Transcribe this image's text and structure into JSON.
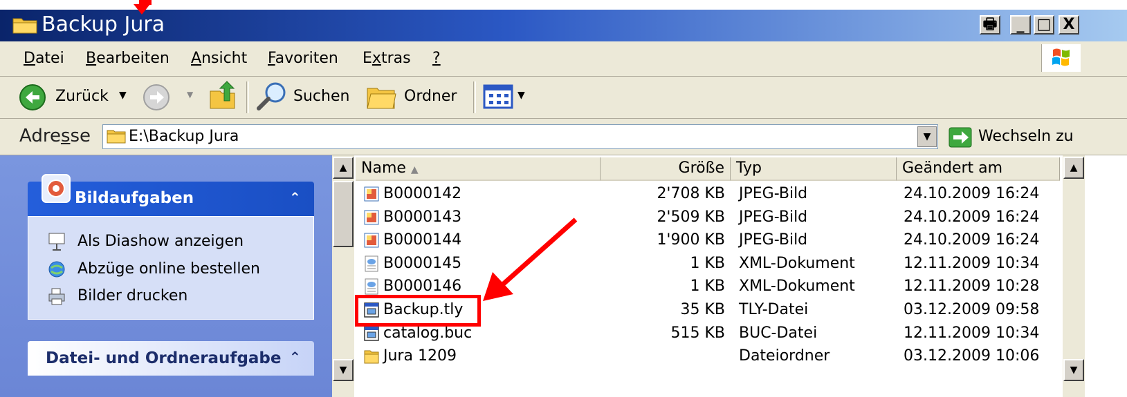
{
  "window": {
    "title": "Backup Jura",
    "buttons": {
      "print": "🖶",
      "minimize": "_",
      "maximize": "□",
      "close": "X"
    }
  },
  "menu": [
    {
      "label": "Datei",
      "u": "D",
      "rest": "atei"
    },
    {
      "label": "Bearbeiten",
      "u": "B",
      "rest": "earbeiten"
    },
    {
      "label": "Ansicht",
      "u": "A",
      "rest": "nsicht"
    },
    {
      "label": "Favoriten",
      "u": "F",
      "rest": "avoriten"
    },
    {
      "label": "Extras",
      "pre": "E",
      "u": "x",
      "rest": "tras"
    },
    {
      "label": "?",
      "u": "?",
      "rest": ""
    }
  ],
  "toolbar": {
    "back_label": "Zurück",
    "search_label": "Suchen",
    "folder_label": "Ordner"
  },
  "address": {
    "label_pre": "Adre",
    "label_u": "s",
    "label_post": "se",
    "value": "E:\\Backup Jura",
    "go_label": "Wechseln zu"
  },
  "left_pane": {
    "panel1_title": "Bildaufgaben",
    "tasks": [
      {
        "label": "Als Diashow anzeigen",
        "icon": "slideshow-icon"
      },
      {
        "label": "Abzüge online bestellen",
        "icon": "order-prints-icon"
      },
      {
        "label": "Bilder drucken",
        "icon": "printer-icon"
      }
    ],
    "panel2_title": "Datei- und Ordneraufgabe",
    "chevron": "⌃"
  },
  "file_list": {
    "columns": [
      "Name",
      "Größe",
      "Typ",
      "Geändert am"
    ],
    "sort_indicator": "▲",
    "rows": [
      {
        "name": "B0000142",
        "size": "2'708 KB",
        "type": "JPEG-Bild",
        "modified": "24.10.2009 16:24",
        "icon": "jpeg-file-icon"
      },
      {
        "name": "B0000143",
        "size": "2'509 KB",
        "type": "JPEG-Bild",
        "modified": "24.10.2009 16:24",
        "icon": "jpeg-file-icon"
      },
      {
        "name": "B0000144",
        "size": "1'900 KB",
        "type": "JPEG-Bild",
        "modified": "24.10.2009 16:24",
        "icon": "jpeg-file-icon"
      },
      {
        "name": "B0000145",
        "size": "1 KB",
        "type": "XML-Dokument",
        "modified": "12.11.2009 10:34",
        "icon": "xml-file-icon"
      },
      {
        "name": "B0000146",
        "size": "1 KB",
        "type": "XML-Dokument",
        "modified": "12.11.2009 10:28",
        "icon": "xml-file-icon"
      },
      {
        "name": "Backup.tly",
        "size": "35 KB",
        "type": "TLY-Datei",
        "modified": "03.12.2009 09:58",
        "icon": "tly-file-icon"
      },
      {
        "name": "catalog.buc",
        "size": "515 KB",
        "type": "BUC-Datei",
        "modified": "12.11.2009 10:34",
        "icon": "buc-file-icon"
      },
      {
        "name": "Jura 1209",
        "size": "",
        "type": "Dateiordner",
        "modified": "03.12.2009 10:06",
        "icon": "folder-icon"
      }
    ]
  },
  "colors": {
    "annotation": "#ff0000",
    "title_bar": "#0a246a",
    "task_pane": "#6b86d6"
  }
}
